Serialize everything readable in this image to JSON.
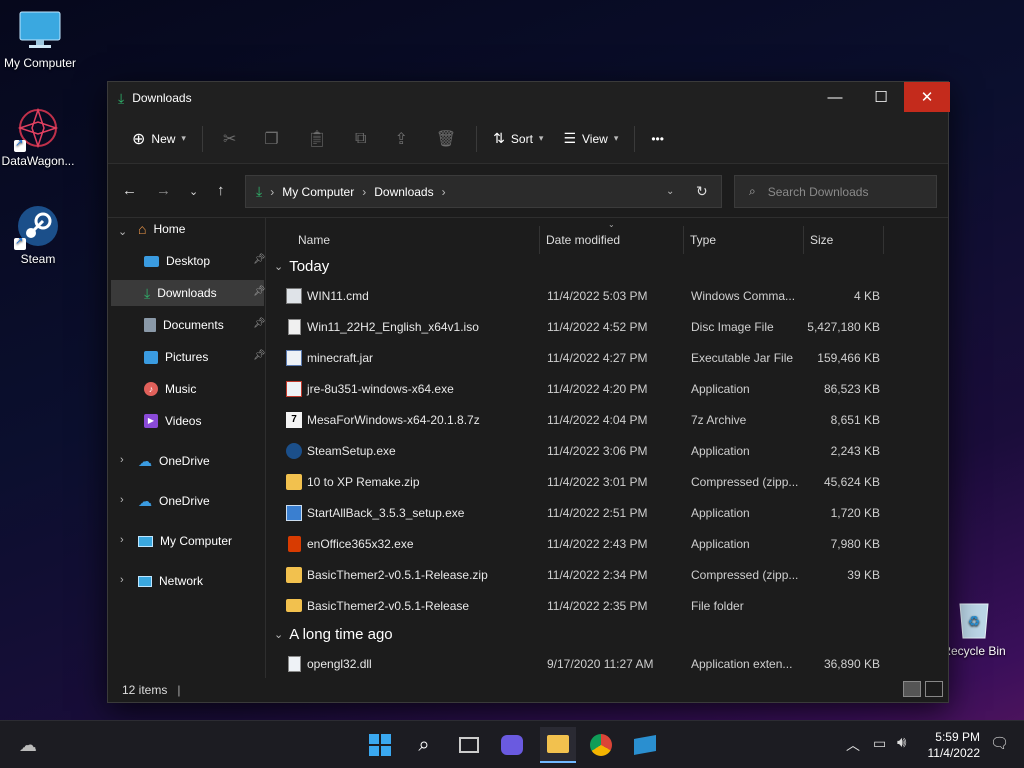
{
  "desktop": {
    "icons": [
      {
        "label": "My Computer",
        "icon": "monitor-icon"
      },
      {
        "label": "DataWagon...",
        "icon": "datawagon-icon"
      },
      {
        "label": "Steam",
        "icon": "steam-icon"
      },
      {
        "label": "Recycle Bin",
        "icon": "recycle-bin-icon"
      }
    ]
  },
  "window": {
    "title": "Downloads",
    "toolbar": {
      "new_label": "New",
      "sort_label": "Sort",
      "view_label": "View",
      "more_label": "•••"
    },
    "address": {
      "crumbs": [
        "My Computer",
        "Downloads"
      ],
      "search_placeholder": "Search Downloads"
    },
    "sidebar": {
      "items": [
        {
          "label": "Home",
          "icon": "home-icon"
        },
        {
          "label": "Desktop",
          "icon": "desktop-folder-icon"
        },
        {
          "label": "Downloads",
          "icon": "download-icon"
        },
        {
          "label": "Documents",
          "icon": "documents-icon"
        },
        {
          "label": "Pictures",
          "icon": "pictures-icon"
        },
        {
          "label": "Music",
          "icon": "music-icon"
        },
        {
          "label": "Videos",
          "icon": "videos-icon"
        },
        {
          "label": "OneDrive",
          "icon": "onedrive-icon"
        },
        {
          "label": "OneDrive",
          "icon": "onedrive-icon"
        },
        {
          "label": "My Computer",
          "icon": "monitor-icon"
        },
        {
          "label": "Network",
          "icon": "network-icon"
        }
      ]
    },
    "columns": [
      "Name",
      "Date modified",
      "Type",
      "Size"
    ],
    "groups": [
      "Today",
      "A long time ago"
    ],
    "files": [
      {
        "name": "WIN11.cmd",
        "date": "11/4/2022 5:03 PM",
        "type": "Windows Comma...",
        "size": "4 KB",
        "icon": "cmd-file-icon"
      },
      {
        "name": "Win11_22H2_English_x64v1.iso",
        "date": "11/4/2022 4:52 PM",
        "type": "Disc Image File",
        "size": "5,427,180 KB",
        "icon": "disc-image-icon"
      },
      {
        "name": "minecraft.jar",
        "date": "11/4/2022 4:27 PM",
        "type": "Executable Jar File",
        "size": "159,466 KB",
        "icon": "java-jar-icon"
      },
      {
        "name": "jre-8u351-windows-x64.exe",
        "date": "11/4/2022 4:20 PM",
        "type": "Application",
        "size": "86,523 KB",
        "icon": "java-installer-icon"
      },
      {
        "name": "MesaForWindows-x64-20.1.8.7z",
        "date": "11/4/2022 4:04 PM",
        "type": "7z Archive",
        "size": "8,651 KB",
        "icon": "7z-archive-icon"
      },
      {
        "name": "SteamSetup.exe",
        "date": "11/4/2022 3:06 PM",
        "type": "Application",
        "size": "2,243 KB",
        "icon": "steam-setup-icon"
      },
      {
        "name": "10 to XP Remake.zip",
        "date": "11/4/2022 3:01 PM",
        "type": "Compressed (zipp...",
        "size": "45,624 KB",
        "icon": "zip-folder-icon"
      },
      {
        "name": "StartAllBack_3.5.3_setup.exe",
        "date": "11/4/2022 2:51 PM",
        "type": "Application",
        "size": "1,720 KB",
        "icon": "installer-icon"
      },
      {
        "name": "enOffice365x32.exe",
        "date": "11/4/2022 2:43 PM",
        "type": "Application",
        "size": "7,980 KB",
        "icon": "office-icon"
      },
      {
        "name": "BasicThemer2-v0.5.1-Release.zip",
        "date": "11/4/2022 2:34 PM",
        "type": "Compressed (zipp...",
        "size": "39 KB",
        "icon": "zip-folder-icon"
      },
      {
        "name": "BasicThemer2-v0.5.1-Release",
        "date": "11/4/2022 2:35 PM",
        "type": "File folder",
        "size": "",
        "icon": "folder-icon"
      },
      {
        "name": "opengl32.dll",
        "date": "9/17/2020 11:27 AM",
        "type": "Application exten...",
        "size": "36,890 KB",
        "icon": "dll-file-icon"
      }
    ],
    "status": "12 items"
  },
  "taskbar": {
    "time": "5:59 PM",
    "date": "11/4/2022"
  },
  "colors": {
    "accent": "#c42b1c",
    "folder": "#f2c14e",
    "download_green": "#2fb36b",
    "window_bg": "#1c1c1c"
  }
}
